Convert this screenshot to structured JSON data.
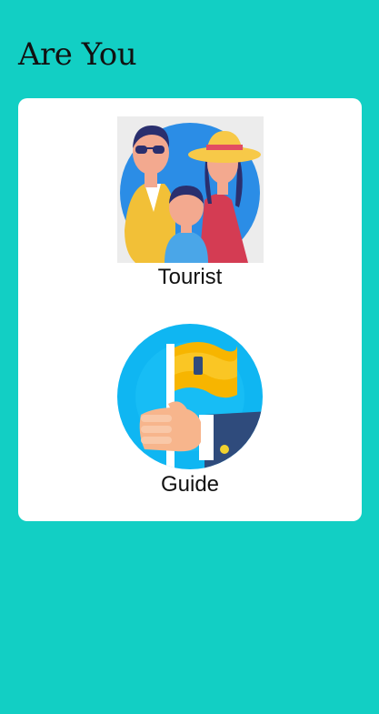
{
  "header": {
    "title": "Are You"
  },
  "options": [
    {
      "label": "Tourist",
      "icon": "tourist-family-icon"
    },
    {
      "label": "Guide",
      "icon": "guide-flag-icon"
    }
  ],
  "colors": {
    "background": "#12cfc4",
    "card": "#ffffff"
  }
}
